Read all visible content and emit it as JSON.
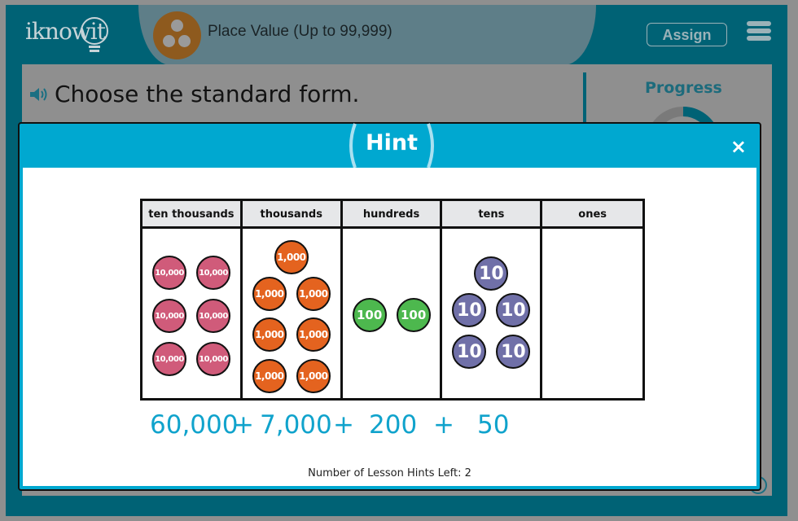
{
  "header": {
    "logo": "iknowit",
    "lesson_title": "Place Value (Up to 99,999)",
    "assign_label": "Assign",
    "menu_icon": "hamburger-icon"
  },
  "question": {
    "text": "Choose the standard form.",
    "speaker_icon": "speaker-icon"
  },
  "sidebar": {
    "progress_label": "Progress"
  },
  "hint": {
    "title": "Hint",
    "close_label": "×",
    "columns": [
      {
        "label": "ten thousands",
        "disc_value": "10,000",
        "count": 6
      },
      {
        "label": "thousands",
        "disc_value": "1,000",
        "count": 7
      },
      {
        "label": "hundreds",
        "disc_value": "100",
        "count": 2
      },
      {
        "label": "tens",
        "disc_value": "10",
        "count": 5
      },
      {
        "label": "ones",
        "disc_value": "",
        "count": 0
      }
    ],
    "expanded_form": {
      "terms": [
        "60,000",
        "7,000",
        "200",
        "50"
      ],
      "plus": "+"
    },
    "hints_left": "Number of Lesson Hints Left: 2"
  },
  "colors": {
    "frame": "#006275",
    "modal_header": "#00a8d0",
    "ten_thousands_disc": "#d05b7a",
    "thousands_disc": "#e4631f",
    "hundreds_disc": "#4db84e",
    "tens_disc": "#7070a8",
    "expanded_text": "#10a3cc"
  }
}
